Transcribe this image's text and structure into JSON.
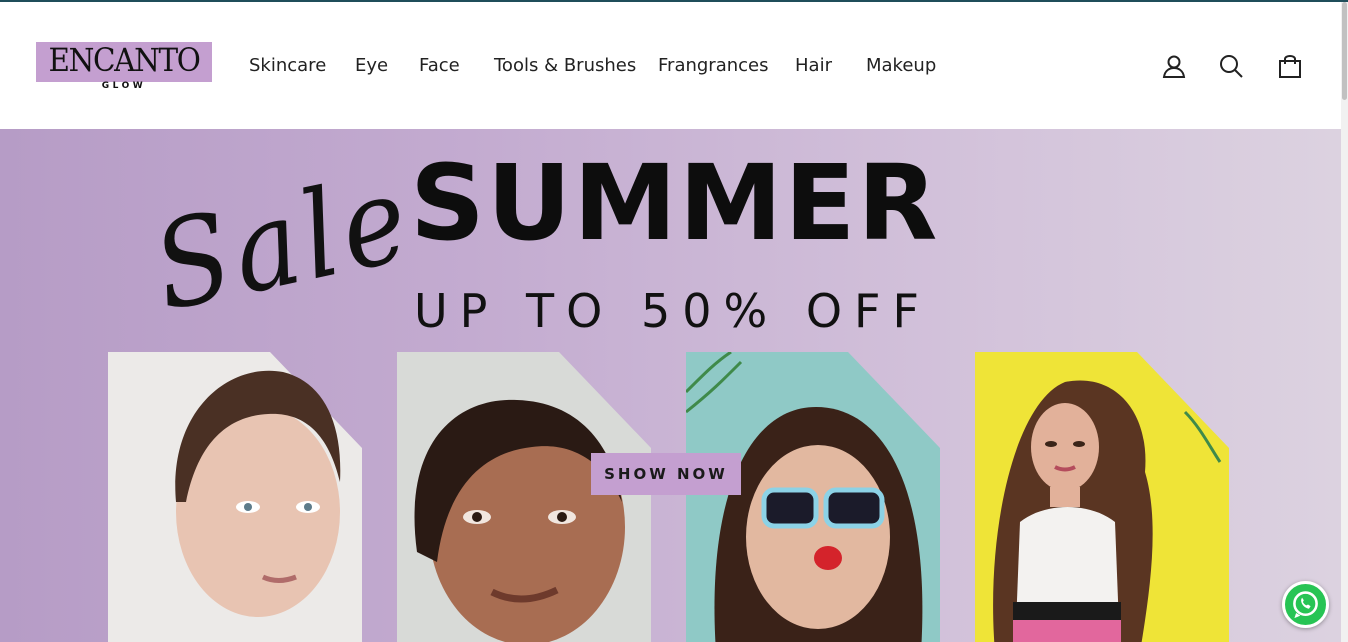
{
  "brand": {
    "name": "ENCANTO",
    "tagline": "GLOW",
    "accent": "#c49fd0"
  },
  "nav": {
    "items": [
      {
        "label": "Skincare"
      },
      {
        "label": "Eye"
      },
      {
        "label": "Face"
      },
      {
        "label": "Tools & Brushes"
      },
      {
        "label": "Frangrances"
      },
      {
        "label": "Hair"
      },
      {
        "label": "Makeup"
      }
    ]
  },
  "header_icons": [
    "account-icon",
    "search-icon",
    "cart-icon"
  ],
  "hero": {
    "script_text": "Sale",
    "headline": "SUMMER",
    "subheadline": "UP TO 50% OFF",
    "cta_label": "SHOW NOW",
    "background": "#c3abd0"
  },
  "floating": {
    "whatsapp": "whatsapp-icon",
    "color": "#27c454"
  }
}
